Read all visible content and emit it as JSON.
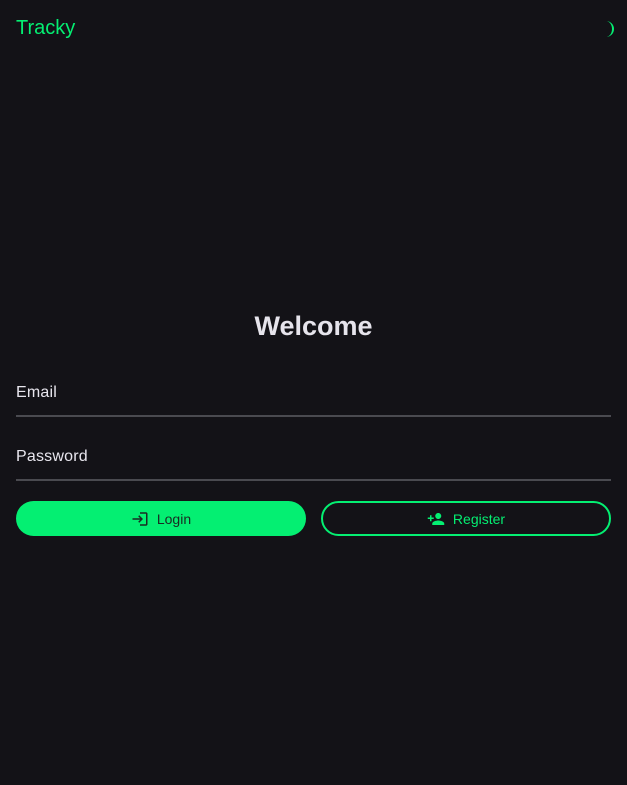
{
  "header": {
    "brand": "Tracky",
    "theme_toggle_icon": "moon-icon"
  },
  "main": {
    "title": "Welcome",
    "email": {
      "label": "Email",
      "value": ""
    },
    "password": {
      "label": "Password",
      "value": ""
    },
    "login_button": {
      "label": "Login",
      "icon": "login-icon"
    },
    "register_button": {
      "label": "Register",
      "icon": "person-add-icon"
    }
  },
  "colors": {
    "accent": "#04ef72",
    "background": "#131217",
    "text": "#e6e4ec",
    "underline": "#4a4a50"
  }
}
